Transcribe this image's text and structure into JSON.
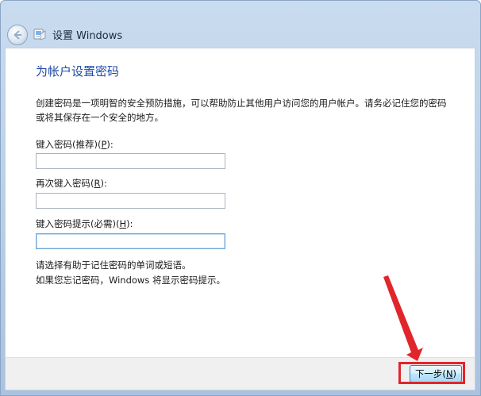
{
  "window": {
    "title": "设置 Windows"
  },
  "page": {
    "heading": "为帐户设置密码",
    "description": "创建密码是一项明智的安全预防措施，可以帮助防止其他用户访问您的用户帐户。请务必记住您的密码或将其保存在一个安全的地方。"
  },
  "fields": {
    "password": {
      "label": "键入密码(推荐)(",
      "accel": "P",
      "label_end": "):",
      "value": ""
    },
    "confirm": {
      "label": "再次键入密码(",
      "accel": "R",
      "label_end": "):",
      "value": ""
    },
    "hint": {
      "label": "键入密码提示(必需)(",
      "accel": "H",
      "label_end": "):",
      "value": ""
    }
  },
  "hint_text": {
    "line1": "请选择有助于记住密码的单词或短语。",
    "line2": "如果您忘记密码，Windows 将显示密码提示。"
  },
  "footer": {
    "next_label": "下一步(",
    "next_accel": "N",
    "next_label_end": ")"
  },
  "colors": {
    "heading": "#1e4aa8",
    "annotation": "#e0262c"
  },
  "icons": {
    "back": "back-arrow-icon",
    "app": "windows-setup-icon"
  }
}
